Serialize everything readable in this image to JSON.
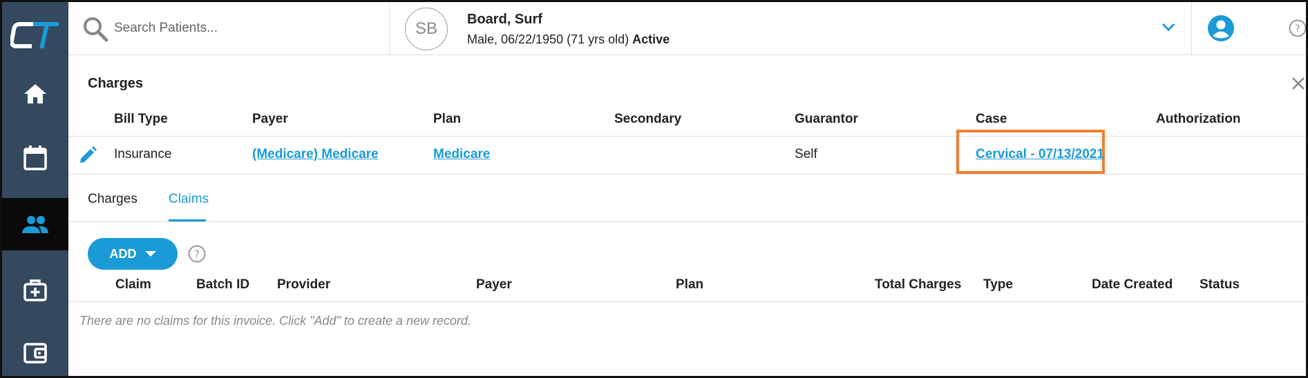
{
  "brand": {
    "logo_text": "CT",
    "accent": "#1a9bd7",
    "sidebar_bg": "#34495e",
    "highlight": "#f08030"
  },
  "sidebar": {
    "items": [
      {
        "icon": "home-icon",
        "active": false
      },
      {
        "icon": "calendar-icon",
        "active": false
      },
      {
        "icon": "patients-icon",
        "active": true
      },
      {
        "icon": "medical-kit-icon",
        "active": false
      },
      {
        "icon": "wallet-icon",
        "active": false
      }
    ]
  },
  "header": {
    "search_placeholder": "Search Patients...",
    "patient": {
      "initials": "SB",
      "name": "Board, Surf",
      "details": "Male, 06/22/1950 (71 yrs old)",
      "status": "Active"
    }
  },
  "charges": {
    "title": "Charges",
    "columns": [
      "Bill Type",
      "Payer",
      "Plan",
      "Secondary",
      "Guarantor",
      "Case",
      "Authorization"
    ],
    "row": {
      "bill_type": "Insurance",
      "payer": "(Medicare) Medicare",
      "plan": "Medicare",
      "secondary": "",
      "guarantor": "Self",
      "case": "Cervical - 07/13/2021",
      "authorization": ""
    }
  },
  "tabs": [
    {
      "label": "Charges",
      "active": false
    },
    {
      "label": "Claims",
      "active": true
    }
  ],
  "claims": {
    "add_label": "ADD",
    "columns": [
      "Claim",
      "Batch ID",
      "Provider",
      "Payer",
      "Plan",
      "Total Charges",
      "Type",
      "Date Created",
      "Status"
    ],
    "empty_message": "There are no claims for this invoice. Click \"Add\" to create a new record."
  }
}
